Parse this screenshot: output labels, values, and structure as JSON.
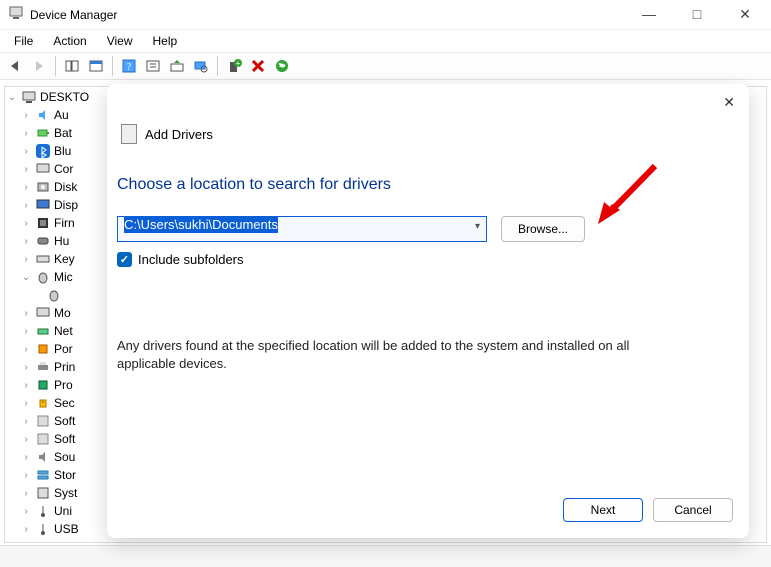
{
  "window": {
    "title": "Device Manager"
  },
  "menubar": [
    "File",
    "Action",
    "View",
    "Help"
  ],
  "tree": {
    "root": "DESKTO",
    "items": [
      {
        "exp": ">",
        "label": "Au",
        "kind": "audio"
      },
      {
        "exp": ">",
        "label": "Bat",
        "kind": "battery"
      },
      {
        "exp": ">",
        "label": "Blu",
        "kind": "bluetooth"
      },
      {
        "exp": ">",
        "label": "Cor",
        "kind": "computer"
      },
      {
        "exp": ">",
        "label": "Disk",
        "kind": "disk"
      },
      {
        "exp": ">",
        "label": "Disp",
        "kind": "display"
      },
      {
        "exp": ">",
        "label": "Firn",
        "kind": "firmware"
      },
      {
        "exp": ">",
        "label": "Hu",
        "kind": "hid"
      },
      {
        "exp": ">",
        "label": "Key",
        "kind": "keyboard"
      },
      {
        "exp": "v",
        "label": "Mic",
        "kind": "mouse",
        "expanded": true
      },
      {
        "exp": ">",
        "label": "Mo",
        "kind": "monitor"
      },
      {
        "exp": ">",
        "label": "Net",
        "kind": "network"
      },
      {
        "exp": ">",
        "label": "Por",
        "kind": "ports"
      },
      {
        "exp": ">",
        "label": "Prin",
        "kind": "print"
      },
      {
        "exp": ">",
        "label": "Pro",
        "kind": "processor"
      },
      {
        "exp": ">",
        "label": "Sec",
        "kind": "security"
      },
      {
        "exp": ">",
        "label": "Soft",
        "kind": "software"
      },
      {
        "exp": ">",
        "label": "Soft",
        "kind": "software"
      },
      {
        "exp": ">",
        "label": "Sou",
        "kind": "sound"
      },
      {
        "exp": ">",
        "label": "Stor",
        "kind": "storage"
      },
      {
        "exp": ">",
        "label": "Syst",
        "kind": "system"
      },
      {
        "exp": ">",
        "label": "Uni",
        "kind": "usb"
      },
      {
        "exp": ">",
        "label": "USB",
        "kind": "usb"
      }
    ],
    "mouse_child": ""
  },
  "dialog": {
    "crumb": "Add Drivers",
    "title": "Choose a location to search for drivers",
    "path_value": "C:\\Users\\sukhi\\Documents",
    "browse": "Browse...",
    "include_label": "Include subfolders",
    "include_checked": true,
    "description": "Any drivers found at the specified location will be added to the system and installed on all applicable devices.",
    "next": "Next",
    "cancel": "Cancel"
  }
}
